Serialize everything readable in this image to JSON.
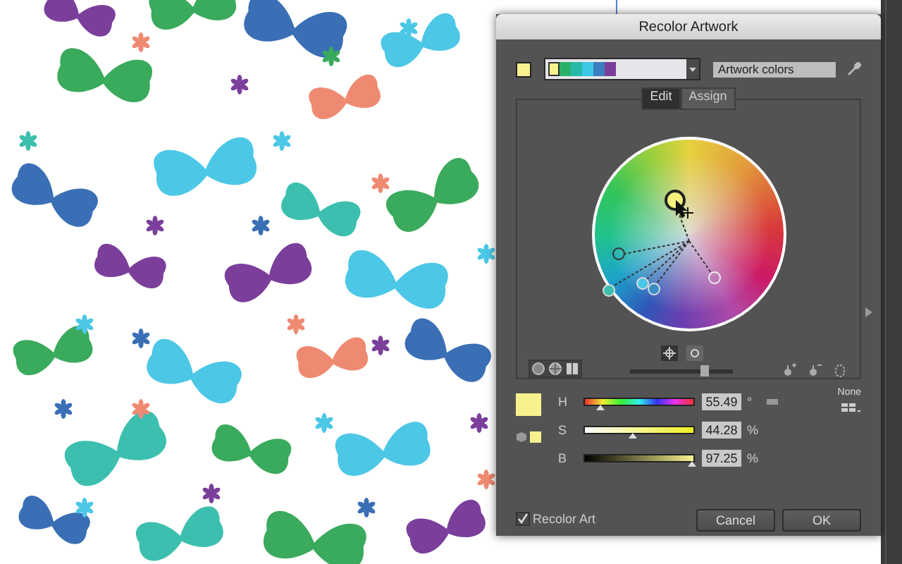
{
  "window": {
    "title": "Recolor Artwork"
  },
  "wheel_brightness": {
    "level": 0.72
  },
  "tabs": [
    {
      "label": "Edit",
      "selected": true
    },
    {
      "label": "Assign",
      "selected": false
    }
  ],
  "color_group": {
    "value": "Artwork colors"
  },
  "hsb": [
    {
      "label": "H",
      "level": 0.154,
      "reading": "55.49",
      "unit": "°",
      "kind": "hue"
    },
    {
      "label": "S",
      "level": 0.44,
      "reading": "44.28",
      "unit": "%",
      "kind": "saturation"
    },
    {
      "label": "B",
      "level": 0.97,
      "reading": "97.25",
      "unit": "%",
      "kind": "brightness"
    }
  ],
  "none_label": "None",
  "recolor_art": {
    "label": "Recolor Art",
    "checked": true
  },
  "buttons": [
    "Cancel",
    "OK"
  ]
}
